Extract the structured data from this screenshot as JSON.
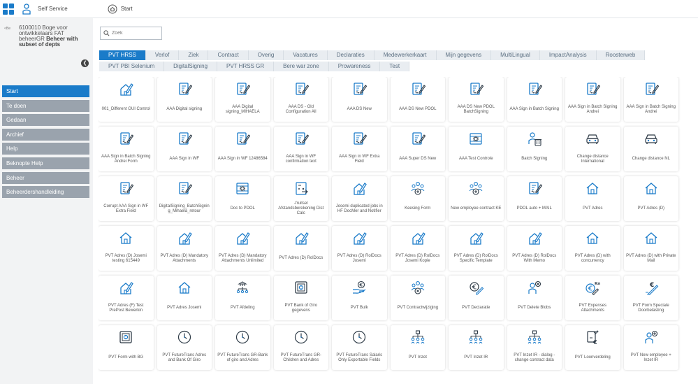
{
  "header": {
    "self_service_label": "Self Service",
    "start_label": "Start"
  },
  "user": {
    "line1": "6100010 Boge voor",
    "line2": "ontwikkelaars FAT",
    "line3_normal": "beheerGR ",
    "line3_bold": "Beheer with",
    "line4_bold": "subset of depts",
    "avatar_alt": "<Be"
  },
  "search": {
    "placeholder": "Zoek"
  },
  "nav": [
    {
      "label": "Start",
      "active": true
    },
    {
      "label": "Te doen"
    },
    {
      "label": "Gedaan"
    },
    {
      "label": "Archief"
    },
    {
      "label": "Help"
    },
    {
      "label": "Beknopte Help"
    },
    {
      "label": "Beheer"
    },
    {
      "label": "Beheerdershandleiding"
    }
  ],
  "tabs": [
    {
      "label": "PVT HRSS",
      "active": true
    },
    {
      "label": "Verlof"
    },
    {
      "label": "Ziek"
    },
    {
      "label": "Contract"
    },
    {
      "label": "Overig"
    },
    {
      "label": "Vacatures"
    },
    {
      "label": "Declaraties"
    },
    {
      "label": "Medewerkerkaart"
    },
    {
      "label": "Mijn gegevens"
    },
    {
      "label": "MultiLingual"
    },
    {
      "label": "ImpactAnalysis"
    },
    {
      "label": "Roosterweb"
    },
    {
      "label": "PVT PBI Selenium"
    },
    {
      "label": "DigitalSigning"
    },
    {
      "label": "PVT HRSS GR"
    },
    {
      "label": "Bere war zone"
    },
    {
      "label": "Prowareness"
    },
    {
      "label": "Test"
    }
  ],
  "colors": {
    "accent": "#1a7bc9",
    "nav_inactive": "#9aa3ad"
  },
  "tiles": [
    {
      "label": "001_Different GUI Control",
      "icon": "house-edit"
    },
    {
      "label": "AAA Digital signing",
      "icon": "doc-sign"
    },
    {
      "label": "AAA Digital signing_MIHAELA",
      "icon": "doc-sign"
    },
    {
      "label": "AAA DS - Old Configuration All",
      "icon": "doc-sign"
    },
    {
      "label": "AAA DS New",
      "icon": "doc-sign"
    },
    {
      "label": "AAA DS New PDOL",
      "icon": "doc-sign"
    },
    {
      "label": "AAA DS New PDOL BatchSigning",
      "icon": "doc-sign"
    },
    {
      "label": "AAA Sign in Batch Signing",
      "icon": "doc-sign"
    },
    {
      "label": "AAA Sign in Batch Signing Andrei",
      "icon": "doc-sign"
    },
    {
      "label": "AAA Sign in Batch Signing Andrei",
      "icon": "doc-sign"
    },
    {
      "label": "AAA Sign in Batch Signing Andrei Form",
      "icon": "doc-sign"
    },
    {
      "label": "AAA Sign in WF",
      "icon": "doc-sign"
    },
    {
      "label": "AAA Sign in WF 12486584",
      "icon": "doc-sign"
    },
    {
      "label": "AAA Sign in WF confirmation text",
      "icon": "doc-sign"
    },
    {
      "label": "AAA Sign in WF Extra Field",
      "icon": "doc-sign"
    },
    {
      "label": "AAA Super DS New",
      "icon": "doc-sign"
    },
    {
      "label": "AAA Test Controle",
      "icon": "server-gear"
    },
    {
      "label": "Batch Signing",
      "icon": "person-delete"
    },
    {
      "label": "Change distance International",
      "icon": "car"
    },
    {
      "label": "Change distance NL",
      "icon": "car"
    },
    {
      "label": "Corrupt AAA Sign in WF Extra Field",
      "icon": "doc-sign"
    },
    {
      "label": "DigitalSigning_BatchSigning_Mihaela_retour",
      "icon": "doc-sign"
    },
    {
      "label": "Doc to PDOL",
      "icon": "server-gear"
    },
    {
      "label": "-fruitsel Afstandsberekening Dist Calc",
      "icon": "calc"
    },
    {
      "label": "Josemi duplicated jobs in HF DocMer and Notifier",
      "icon": "house-edit"
    },
    {
      "label": "Keesing Form",
      "icon": "people-add"
    },
    {
      "label": "New employee contract KE",
      "icon": "people-add"
    },
    {
      "label": "PDOL auto + MAIL",
      "icon": "doc-sign"
    },
    {
      "label": "PVT Adres",
      "icon": "house"
    },
    {
      "label": "PVT Adres (D)",
      "icon": "house"
    },
    {
      "label": "PVT Adres (D) Josemi testing 615449",
      "icon": "house"
    },
    {
      "label": "PVT Adres (D) Mandatory Attachments",
      "icon": "house-edit"
    },
    {
      "label": "PVT Adres (D) Mandatory Attachments Unlimited",
      "icon": "house-edit"
    },
    {
      "label": "PVT Adres (D) RolDocs",
      "icon": "house-edit"
    },
    {
      "label": "PVT Adres (D) RolDocs Josemi",
      "icon": "house-edit"
    },
    {
      "label": "PVT Adres (D) RolDocs Josemi Kopie",
      "icon": "house-edit"
    },
    {
      "label": "PVT Adres (D) RolDocs Specific Template",
      "icon": "house-edit"
    },
    {
      "label": "PVT Adres (D) RolDocs With Memo",
      "icon": "house-edit"
    },
    {
      "label": "PVT Adres (D) with concurrency",
      "icon": "house"
    },
    {
      "label": "PVT Adres (D) with Private Mail",
      "icon": "house"
    },
    {
      "label": "PVT Adres (F) Test PrePost Bewerkin",
      "icon": "house-edit"
    },
    {
      "label": "PVT Adres Josemi",
      "icon": "house"
    },
    {
      "label": "PVT Afdeling",
      "icon": "org-bank"
    },
    {
      "label": "PVT Bank of Giro gegevens",
      "icon": "safe"
    },
    {
      "label": "PVT Bulk",
      "icon": "hand-euro"
    },
    {
      "label": "PVT Contractwijziging",
      "icon": "people-remove"
    },
    {
      "label": "PVT Declaratie",
      "icon": "euro-pen"
    },
    {
      "label": "PVT Delete Blobs",
      "icon": "person-x"
    },
    {
      "label": "PVT Expenses Attachments",
      "icon": "euro-km"
    },
    {
      "label": "PVT Form Speciale Doorbelasting",
      "icon": "euro-pen2"
    },
    {
      "label": "PVT Form with BG",
      "icon": "safe"
    },
    {
      "label": "PVT FutureTrans Adres and Bank Of Giro",
      "icon": "clock"
    },
    {
      "label": "PVT FutureTrans GR-Bank of giro and Adres",
      "icon": "clock"
    },
    {
      "label": "PVT FutureTrans GR-Children and Adres",
      "icon": "clock"
    },
    {
      "label": "PVT FutureTrans Salaris Only Exportable Fields",
      "icon": "clock"
    },
    {
      "label": "PVT Inzet",
      "icon": "org"
    },
    {
      "label": "PVT Inzet IR",
      "icon": "org"
    },
    {
      "label": "PVT Inzet IR - dialog - change contract data",
      "icon": "org"
    },
    {
      "label": "PVT Loonverdeling",
      "icon": "doc-euro"
    },
    {
      "label": "PVT New employee + Inzet IR",
      "icon": "person-add"
    }
  ]
}
